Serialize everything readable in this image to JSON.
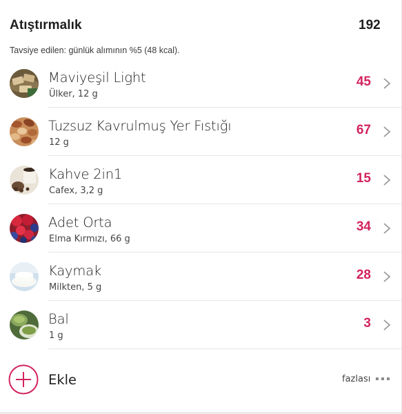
{
  "section": {
    "title": "Atıştırmalık",
    "total_kcal": "192",
    "recommendation": "Tavsiye edilen: günlük alımının %5 (48 kcal)."
  },
  "items": [
    {
      "name": "Maviyeşil Light",
      "detail": "Ülker, 12 g",
      "kcal": "45",
      "icon": "crackers-icon"
    },
    {
      "name": "Tuzsuz Kavrulmuş Yer Fıstığı",
      "detail": "12 g",
      "kcal": "67",
      "icon": "nuts-icon"
    },
    {
      "name": "Kahve 2in1",
      "detail": "Cafex, 3,2 g",
      "kcal": "15",
      "icon": "coffee-icon"
    },
    {
      "name": "Adet Orta",
      "detail": "Elma Kırmızı, 66 g",
      "kcal": "34",
      "icon": "berries-icon"
    },
    {
      "name": "Kaymak",
      "detail": "Milkten, 5 g",
      "kcal": "28",
      "icon": "cream-icon"
    },
    {
      "name": "Bal",
      "detail": "1 g",
      "kcal": "3",
      "icon": "matcha-icon"
    }
  ],
  "footer": {
    "add_label": "Ekle",
    "more_label": "fazlası"
  },
  "colors": {
    "accent": "#d3245e",
    "text": "#1e1e1e",
    "divider": "#e6e6e6"
  }
}
